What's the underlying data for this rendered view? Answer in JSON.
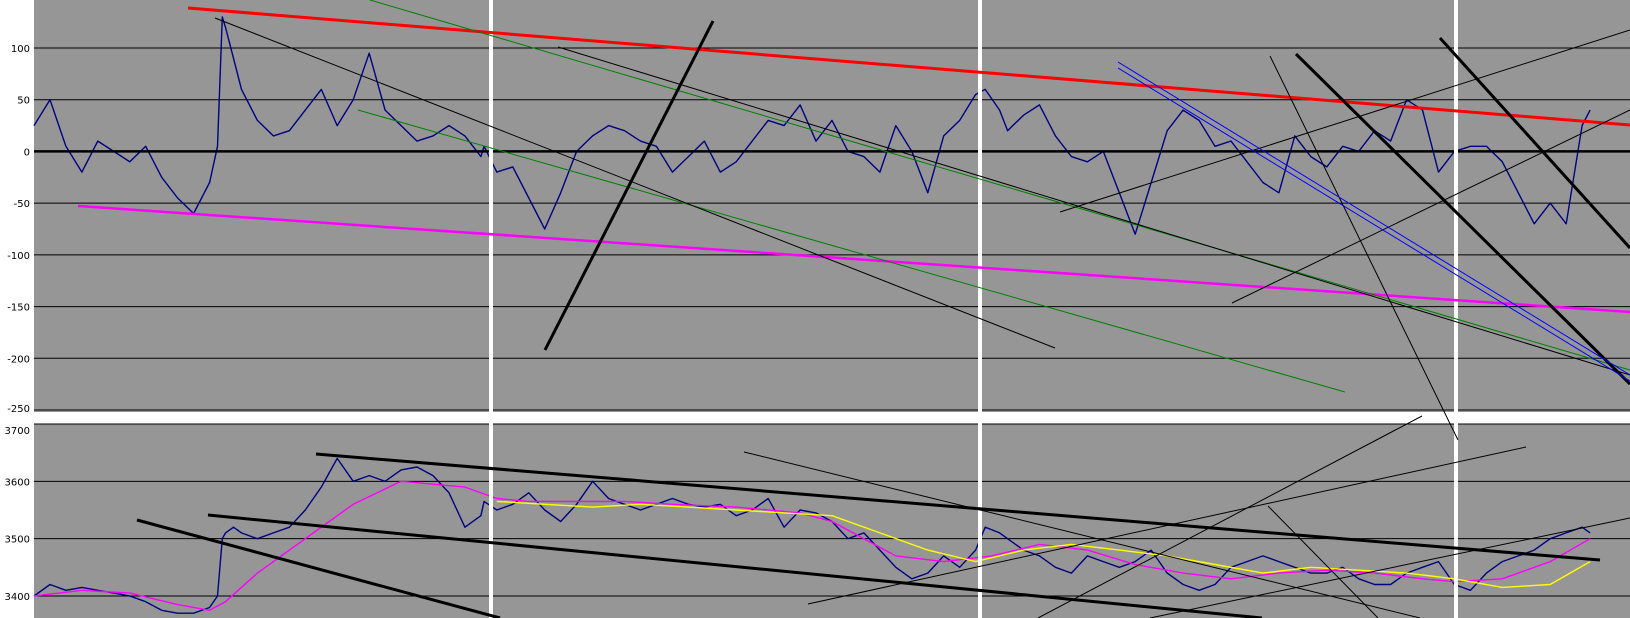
{
  "colors": {
    "page_background": "#ffffff",
    "plot_background": "#969696",
    "gridline": "#000000",
    "pane_separator": "#ffffff",
    "price_line": "#000080",
    "ma_fast": "#ff00ff",
    "ma_slow": "#ffff00",
    "trend_red": "#ff0000",
    "trend_magenta": "#ff00ff",
    "trend_green": "#008000",
    "trend_blue": "#0000ff",
    "trend_black": "#000000"
  },
  "chart_data": [
    {
      "type": "line",
      "name": "upper oscillator",
      "y_ticks": [
        "100",
        "50",
        "0",
        "-50",
        "-100",
        "-150",
        "-200",
        "-250"
      ],
      "ylim": [
        -250,
        130
      ],
      "x_range": [
        0,
        1000
      ],
      "grid": true,
      "zero_line": true,
      "series": [
        {
          "color": "#000080",
          "x": [
            0,
            10,
            20,
            30,
            40,
            50,
            60,
            70,
            80,
            90,
            100,
            110,
            115,
            118,
            120,
            125,
            130,
            140,
            150,
            160,
            170,
            180,
            190,
            200,
            210,
            220,
            230,
            240,
            250,
            260,
            270,
            280,
            282,
            290,
            300,
            310,
            320,
            330,
            340,
            350,
            360,
            370,
            380,
            390,
            400,
            410,
            420,
            430,
            440,
            450,
            460,
            470,
            480,
            490,
            500,
            510,
            520,
            530,
            540,
            550,
            560,
            570,
            580,
            590,
            596,
            605,
            610,
            620,
            630,
            640,
            650,
            660,
            670,
            680,
            690,
            700,
            710,
            720,
            730,
            740,
            750,
            760,
            770,
            780,
            790,
            800,
            810,
            820,
            830,
            840,
            850,
            860,
            870,
            880,
            890,
            900,
            910,
            920,
            930,
            940,
            950,
            960,
            970,
            975
          ],
          "y": [
            25,
            50,
            5,
            -20,
            10,
            0,
            -10,
            5,
            -25,
            -45,
            -60,
            -30,
            5,
            130,
            120,
            90,
            60,
            30,
            15,
            20,
            40,
            60,
            25,
            50,
            95,
            40,
            25,
            10,
            15,
            25,
            15,
            -5,
            5,
            -20,
            -15,
            -45,
            -75,
            -40,
            0,
            15,
            25,
            20,
            10,
            5,
            -20,
            -5,
            10,
            -20,
            -10,
            10,
            30,
            25,
            45,
            10,
            30,
            0,
            -5,
            -20,
            25,
            0,
            -40,
            15,
            30,
            55,
            60,
            40,
            20,
            35,
            45,
            15,
            -5,
            -10,
            0,
            -40,
            -80,
            -30,
            20,
            40,
            30,
            5,
            10,
            -10,
            -30,
            -40,
            15,
            -5,
            -15,
            5,
            0,
            20,
            10,
            50,
            40,
            -20,
            0,
            5,
            5,
            -10,
            -40,
            -70,
            -50,
            -70,
            25,
            40
          ]
        },
        {
          "color": "#000000",
          "x": [
            0,
            1000
          ],
          "y": [
            0,
            0
          ]
        }
      ]
    },
    {
      "type": "line",
      "name": "lower price",
      "y_ticks": [
        "3700",
        "3600",
        "3500",
        "3400"
      ],
      "ylim": [
        3365,
        3700
      ],
      "x_range": [
        0,
        1000
      ],
      "grid": true,
      "series": [
        {
          "color": "#000080",
          "x": [
            0,
            10,
            20,
            30,
            40,
            50,
            60,
            70,
            80,
            90,
            100,
            110,
            115,
            118,
            120,
            125,
            130,
            140,
            150,
            160,
            170,
            180,
            190,
            200,
            210,
            220,
            230,
            240,
            250,
            260,
            270,
            280,
            282,
            290,
            300,
            310,
            320,
            330,
            340,
            350,
            360,
            370,
            380,
            390,
            400,
            410,
            420,
            430,
            440,
            450,
            460,
            470,
            480,
            490,
            500,
            510,
            520,
            530,
            540,
            550,
            560,
            570,
            580,
            590,
            596,
            605,
            610,
            620,
            630,
            640,
            650,
            660,
            670,
            680,
            690,
            700,
            710,
            720,
            730,
            740,
            750,
            760,
            770,
            780,
            790,
            800,
            810,
            820,
            830,
            840,
            850,
            860,
            870,
            880,
            890,
            900,
            910,
            920,
            930,
            940,
            950,
            960,
            970,
            975
          ],
          "y": [
            3400,
            3420,
            3410,
            3415,
            3410,
            3405,
            3400,
            3390,
            3375,
            3370,
            3370,
            3380,
            3400,
            3500,
            3510,
            3520,
            3510,
            3500,
            3510,
            3520,
            3550,
            3590,
            3640,
            3600,
            3610,
            3600,
            3620,
            3625,
            3610,
            3580,
            3520,
            3540,
            3565,
            3550,
            3560,
            3580,
            3550,
            3530,
            3560,
            3600,
            3570,
            3560,
            3550,
            3560,
            3570,
            3560,
            3555,
            3560,
            3540,
            3550,
            3570,
            3520,
            3550,
            3545,
            3530,
            3500,
            3510,
            3480,
            3450,
            3430,
            3440,
            3470,
            3450,
            3480,
            3520,
            3510,
            3500,
            3480,
            3470,
            3450,
            3440,
            3470,
            3460,
            3450,
            3460,
            3480,
            3440,
            3420,
            3410,
            3420,
            3450,
            3460,
            3470,
            3460,
            3450,
            3440,
            3440,
            3450,
            3430,
            3420,
            3420,
            3440,
            3450,
            3460,
            3420,
            3410,
            3440,
            3460,
            3470,
            3480,
            3500,
            3510,
            3520,
            3510
          ]
        },
        {
          "color": "#ff00ff",
          "x": [
            0,
            30,
            60,
            90,
            110,
            120,
            140,
            170,
            200,
            230,
            270,
            290,
            310,
            340,
            370,
            400,
            440,
            480,
            500,
            520,
            540,
            570,
            600,
            630,
            660,
            690,
            720,
            750,
            780,
            810,
            840,
            870,
            890,
            920,
            950,
            975
          ],
          "y": [
            3400,
            3410,
            3405,
            3385,
            3375,
            3390,
            3440,
            3500,
            3560,
            3600,
            3590,
            3570,
            3565,
            3565,
            3565,
            3560,
            3555,
            3545,
            3530,
            3500,
            3470,
            3460,
            3470,
            3490,
            3480,
            3455,
            3440,
            3430,
            3440,
            3445,
            3440,
            3430,
            3425,
            3430,
            3460,
            3500
          ]
        },
        {
          "color": "#ffff00",
          "x": [
            290,
            320,
            350,
            380,
            410,
            440,
            470,
            500,
            530,
            560,
            590,
            620,
            650,
            680,
            710,
            740,
            770,
            800,
            830,
            860,
            890,
            920,
            950,
            975
          ],
          "y": [
            3565,
            3560,
            3555,
            3560,
            3555,
            3550,
            3545,
            3540,
            3510,
            3480,
            3460,
            3480,
            3490,
            3480,
            3470,
            3455,
            3440,
            3450,
            3445,
            3440,
            3430,
            3415,
            3420,
            3460
          ]
        }
      ]
    }
  ]
}
